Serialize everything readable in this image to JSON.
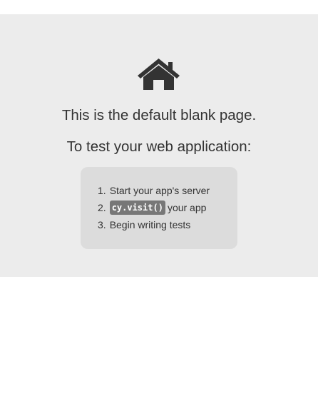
{
  "page": {
    "icon": "home-icon",
    "heading": "This is the default blank page.",
    "subheading": "To test your web application:",
    "steps": [
      {
        "number": "1.",
        "text": "Start your app's server"
      },
      {
        "number": "2.",
        "code": "cy.visit()",
        "text": "your app"
      },
      {
        "number": "3.",
        "text": "Begin writing tests"
      }
    ]
  },
  "colors": {
    "panel_background": "#ececec",
    "box_background": "#dcdcdc",
    "text": "#333333",
    "code_background": "#777777",
    "code_text": "#ffffff"
  }
}
